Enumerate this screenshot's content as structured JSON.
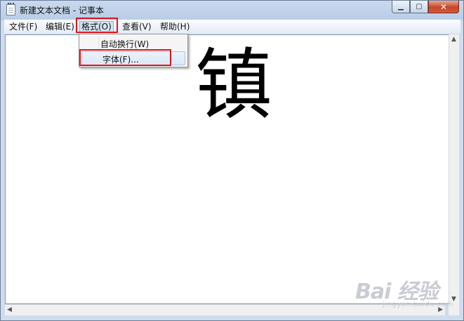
{
  "window": {
    "title": "新建文本文档 - 记事本",
    "controls": {
      "minimize": "▁",
      "maximize": "▢",
      "close": "✕"
    }
  },
  "menubar": {
    "items": [
      {
        "label": "文件(F)"
      },
      {
        "label": "编辑(E)"
      },
      {
        "label": "格式(O)"
      },
      {
        "label": "查看(V)"
      },
      {
        "label": "帮助(H)"
      }
    ]
  },
  "format_menu": {
    "items": [
      {
        "label": "自动换行(W)"
      },
      {
        "label": "字体(F)..."
      }
    ]
  },
  "editor": {
    "content": "镇"
  },
  "watermark": {
    "brand": "Bai 经验",
    "sub": "jingyan.baidu.com"
  },
  "colors": {
    "highlight_box": "#e0141c",
    "title_gradient": "#c9d9ee"
  }
}
